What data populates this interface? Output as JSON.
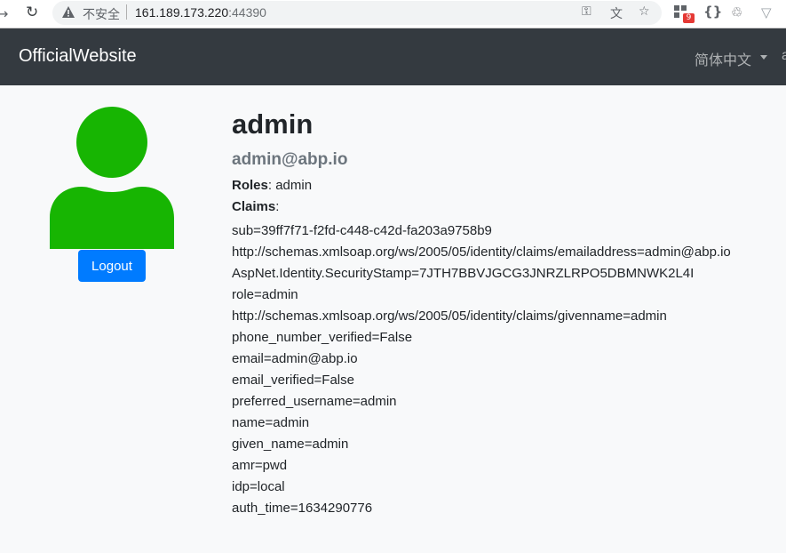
{
  "browser": {
    "insecure_label": "不安全",
    "url_host": "161.189.173.220",
    "url_port": ":44390",
    "extension_badge": "9"
  },
  "navbar": {
    "brand": "OfficialWebsite",
    "language": "简体中文",
    "user_stub": "a"
  },
  "profile": {
    "username": "admin",
    "email": "admin@abp.io",
    "roles_label": "Roles",
    "roles_value": ": admin",
    "claims_label": "Claims",
    "claims_colon": ":",
    "logout_label": "Logout",
    "claims": [
      "sub=39ff7f71-f2fd-c448-c42d-fa203a9758b9",
      "http://schemas.xmlsoap.org/ws/2005/05/identity/claims/emailaddress=admin@abp.io",
      "AspNet.Identity.SecurityStamp=7JTH7BBVJGCG3JNRZLRPO5DBMNWK2L4I",
      "role=admin",
      "http://schemas.xmlsoap.org/ws/2005/05/identity/claims/givenname=admin",
      "phone_number_verified=False",
      "email=admin@abp.io",
      "email_verified=False",
      "preferred_username=admin",
      "name=admin",
      "given_name=admin",
      "amr=pwd",
      "idp=local",
      "auth_time=1634290776"
    ]
  },
  "colors": {
    "avatar": "#17b502",
    "navbar": "#343a40",
    "primary_button": "#007bff",
    "email_text": "#6c757d"
  }
}
